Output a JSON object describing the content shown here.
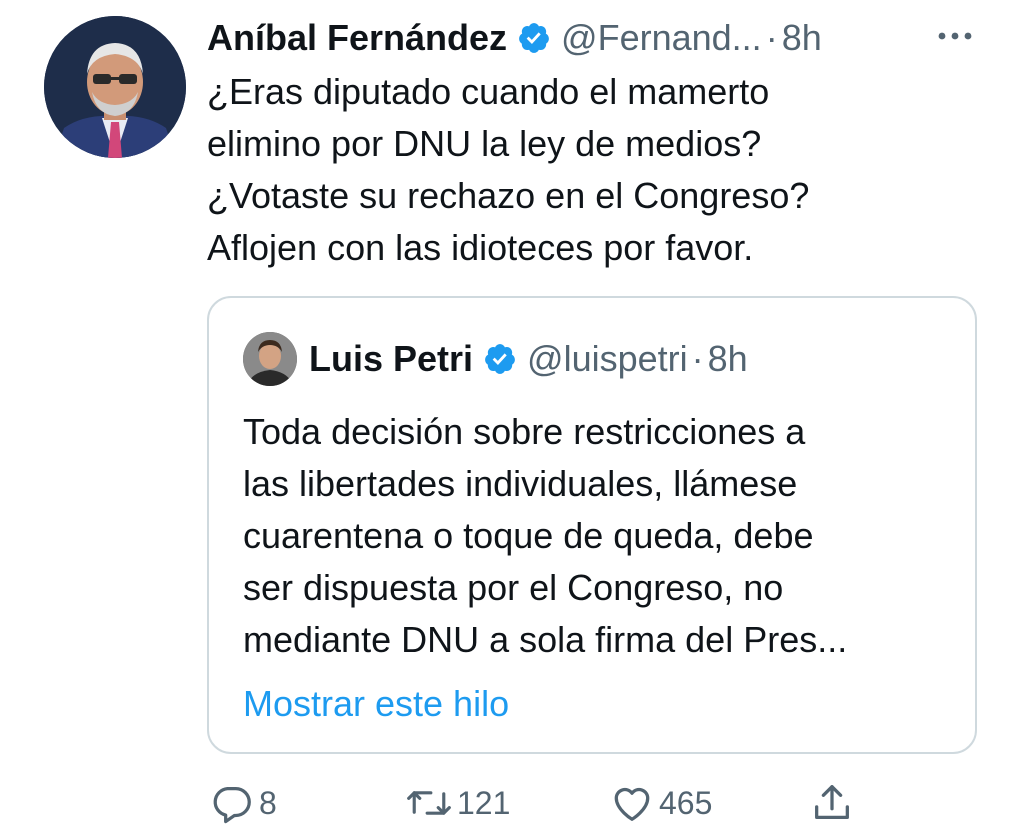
{
  "tweet": {
    "author": {
      "display_name": "Aníbal Fernández",
      "handle": "@Fernand...",
      "time_separator": "·",
      "time": "8h",
      "verified": true
    },
    "text_lines": [
      "¿Eras diputado cuando el mamerto",
      "elimino por DNU la ley de medios?",
      "¿Votaste su rechazo en el Congreso?",
      "Aflojen con las idioteces por favor."
    ],
    "quoted": {
      "author": {
        "display_name": "Luis Petri",
        "handle": "@luispetri",
        "time_separator": "·",
        "time": "8h",
        "verified": true
      },
      "text_lines": [
        "Toda decisión sobre restricciones a",
        "las libertades individuales, llámese",
        "cuarentena o toque de queda, debe",
        "ser dispuesta por el Congreso, no",
        "mediante DNU a sola firma del Pres..."
      ],
      "show_thread": "Mostrar este hilo"
    },
    "actions": {
      "reply": {
        "icon": "reply-icon",
        "count": "8"
      },
      "retweet": {
        "icon": "retweet-icon",
        "count": "121"
      },
      "like": {
        "icon": "heart-icon",
        "count": "465"
      },
      "share": {
        "icon": "share-icon"
      }
    }
  },
  "colors": {
    "text_primary": "#0f1419",
    "text_secondary": "#536471",
    "accent_blue": "#1d9bf0",
    "border": "#cfd9de"
  }
}
